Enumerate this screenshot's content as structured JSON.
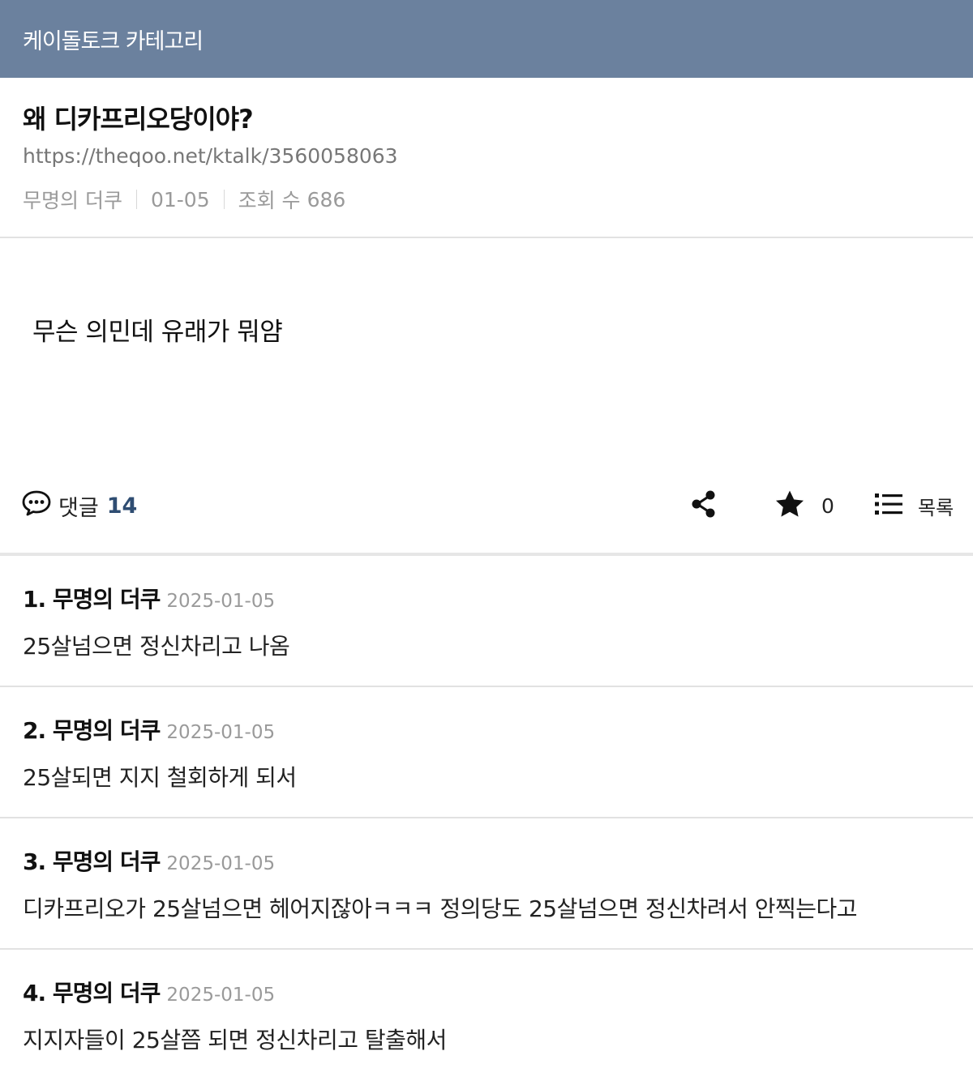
{
  "topbar": {
    "title": "케이돌토크 카테고리"
  },
  "post": {
    "title": "왜 디카프리오당이야?",
    "url": "https://theqoo.net/ktalk/3560058063",
    "author": "무명의 더쿠",
    "date": "01-05",
    "views_label": "조회 수",
    "views": "686",
    "body": "무슨 의민데 유래가 뭐얌"
  },
  "actions": {
    "comment_label": "댓글",
    "comment_count": "14",
    "favorite_count": "0",
    "list_label": "목록",
    "icons": [
      "speech-bubble-icon",
      "share-icon",
      "star-icon",
      "list-icon"
    ]
  },
  "comments": [
    {
      "author": "1. 무명의 더쿠",
      "date": "2025-01-05",
      "text": "25살넘으면 정신차리고 나옴"
    },
    {
      "author": "2. 무명의 더쿠",
      "date": "2025-01-05",
      "text": "25살되면 지지 철회하게 되서"
    },
    {
      "author": "3. 무명의 더쿠",
      "date": "2025-01-05",
      "text": "디카프리오가 25살넘으면 헤어지잖아ㅋㅋㅋ 정의당도 25살넘으면 정신차려서 안찍는다고"
    },
    {
      "author": "4. 무명의 더쿠",
      "date": "2025-01-05",
      "text": "지지자들이 25살쯤 되면 정신차리고 탈출해서"
    }
  ],
  "colors": {
    "header_bg": "#6b819e",
    "count_accent": "#2f4d72"
  }
}
